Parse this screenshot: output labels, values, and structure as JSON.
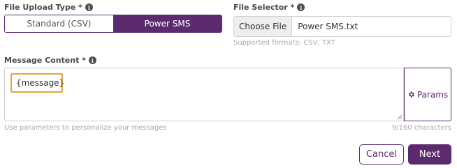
{
  "file_upload_type": {
    "label": "File Upload Type *",
    "options": [
      "Standard (CSV)",
      "Power SMS"
    ],
    "selected": "Power SMS"
  },
  "file_selector": {
    "label": "File Selector *",
    "button_label": "Choose File",
    "file_name": "Power SMS.txt",
    "hint": "Supported formats: CSV, TXT"
  },
  "message_content": {
    "label": "Message Content *",
    "value": "{message}",
    "hint": "Use parameters to personalize your messages",
    "char_count": "9/160 characters"
  },
  "params_button": {
    "label": "Params",
    "icon": "gear-icon"
  },
  "actions": {
    "cancel_label": "Cancel",
    "next_label": "Next"
  },
  "colors": {
    "accent": "#5c2b6e",
    "highlight": "#e0a83a",
    "hint": "#a8a8a8"
  },
  "info_glyph": "i"
}
